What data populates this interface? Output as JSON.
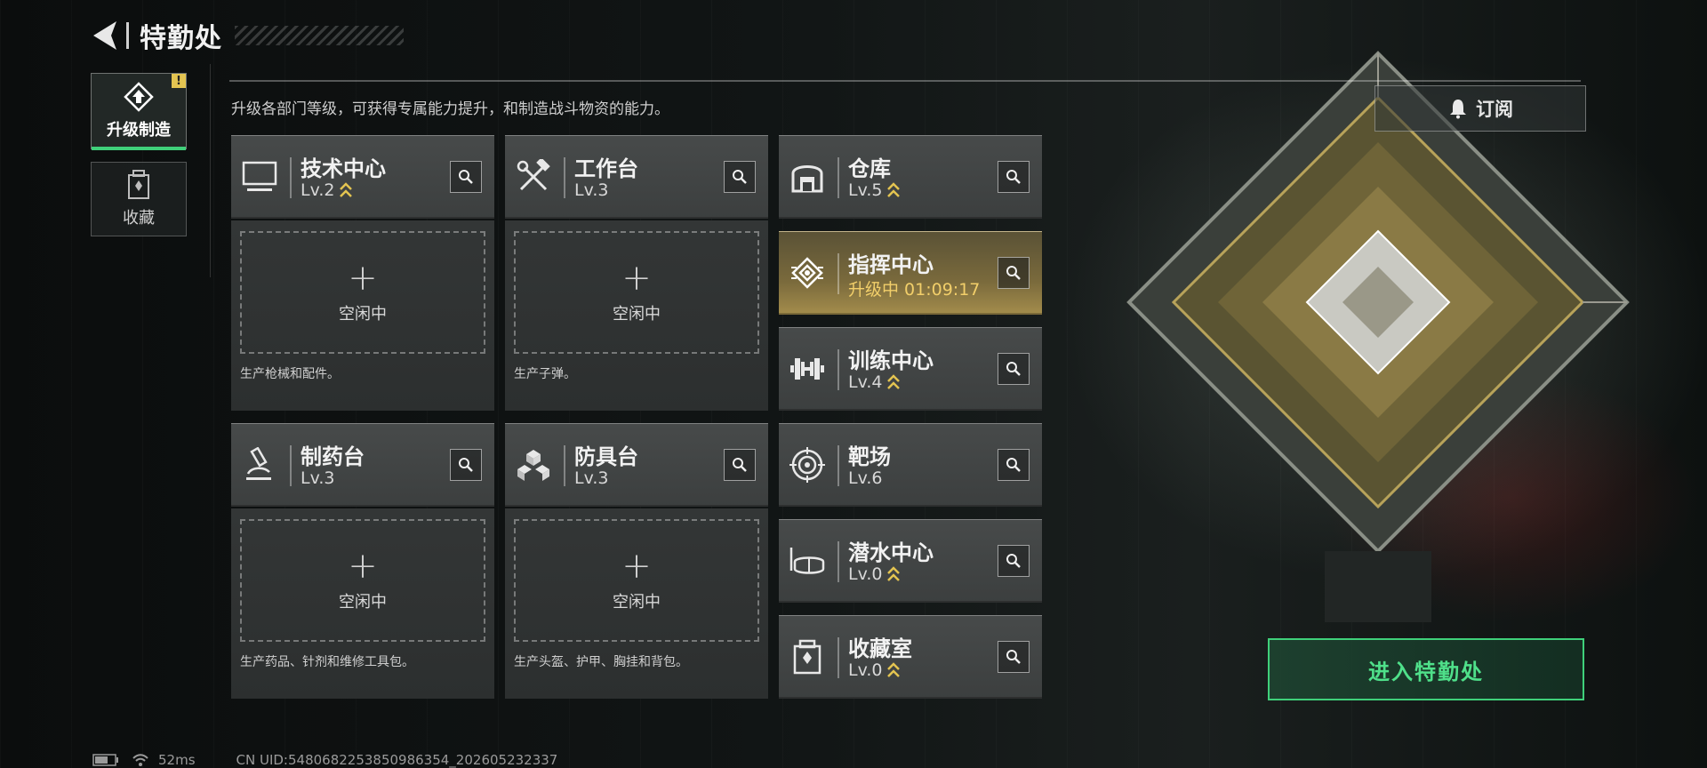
{
  "header": {
    "title": "特勤处"
  },
  "sidebar": {
    "items": [
      {
        "label": "升级制造",
        "active": true,
        "badge": "!"
      },
      {
        "label": "收藏",
        "active": false
      }
    ]
  },
  "description": "升级各部门等级，可获得专属能力提升，和制造战斗物资的能力。",
  "subscribe": {
    "label": "订阅"
  },
  "production_departments": [
    {
      "name": "技术中心",
      "level": "Lv.2",
      "upgradable": true,
      "slot_plus": "+",
      "slot_status": "空闲中",
      "produces": "生产枪械和配件。"
    },
    {
      "name": "工作台",
      "level": "Lv.3",
      "upgradable": false,
      "slot_plus": "+",
      "slot_status": "空闲中",
      "produces": "生产子弹。"
    },
    {
      "name": "制药台",
      "level": "Lv.3",
      "upgradable": false,
      "slot_plus": "+",
      "slot_status": "空闲中",
      "produces": "生产药品、针剂和维修工具包。"
    },
    {
      "name": "防具台",
      "level": "Lv.3",
      "upgradable": false,
      "slot_plus": "+",
      "slot_status": "空闲中",
      "produces": "生产头盔、护甲、胸挂和背包。"
    }
  ],
  "other_departments": [
    {
      "name": "仓库",
      "level": "Lv.5",
      "upgradable": true,
      "icon": "warehouse-icon"
    },
    {
      "name": "指挥中心",
      "level": "升级中 01:09:17",
      "upgrading": true,
      "icon": "command-chip-icon"
    },
    {
      "name": "训练中心",
      "level": "Lv.4",
      "upgradable": true,
      "icon": "dumbbell-icon"
    },
    {
      "name": "靶场",
      "level": "Lv.6",
      "upgradable": false,
      "icon": "target-icon"
    },
    {
      "name": "潜水中心",
      "level": "Lv.0",
      "upgradable": true,
      "icon": "diving-mask-icon"
    },
    {
      "name": "收藏室",
      "level": "Lv.0",
      "upgradable": true,
      "icon": "collection-room-icon"
    }
  ],
  "enter_button": {
    "label": "进入特勤处"
  },
  "status_bar": {
    "ping": "52ms",
    "uid": "CN UID:5480682253850986354_202605232337"
  },
  "colors": {
    "accent_green": "#3fd07a",
    "upgrade_gold": "#e3c451"
  }
}
